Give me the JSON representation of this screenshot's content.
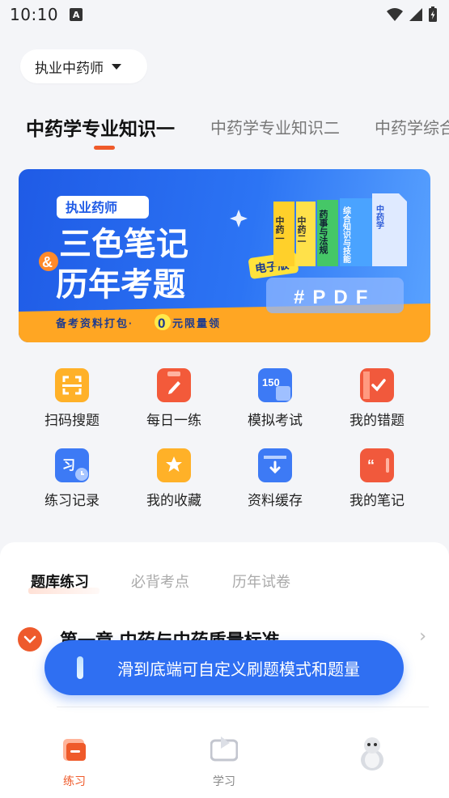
{
  "status_bar": {
    "time": "10:10",
    "notification_icon": "A"
  },
  "exam_selector": {
    "label": "执业中药师",
    "icon": "caret-down-icon"
  },
  "subject_tabs": [
    {
      "label": "中药学专业知识一",
      "active": true
    },
    {
      "label": "中药学专业知识二",
      "active": false
    },
    {
      "label": "中药学综合",
      "active": false
    }
  ],
  "banner": {
    "badge": "执业药师",
    "headline_1": "三色笔记",
    "ampersand": "&",
    "headline_2": "历年考题",
    "edition_tag": "电子版",
    "books": [
      "中药一",
      "中药二",
      "药事与法规",
      "综合知识与技能",
      "中药学"
    ],
    "format_label": "#PDF",
    "footer_text_1": "备考资料打包·",
    "footer_zero": "0",
    "footer_text_2": "元限量领"
  },
  "quick_actions": [
    {
      "label": "扫码搜题",
      "icon": "scan-icon"
    },
    {
      "label": "每日一练",
      "icon": "daily-practice-icon"
    },
    {
      "label": "模拟考试",
      "icon": "mock-exam-icon",
      "icon_text": "150"
    },
    {
      "label": "我的错题",
      "icon": "wrong-questions-icon"
    },
    {
      "label": "练习记录",
      "icon": "practice-record-icon"
    },
    {
      "label": "我的收藏",
      "icon": "favorites-icon"
    },
    {
      "label": "资料缓存",
      "icon": "download-cache-icon"
    },
    {
      "label": "我的笔记",
      "icon": "notes-icon"
    }
  ],
  "sheet_tabs": [
    {
      "label": "题库练习",
      "active": true
    },
    {
      "label": "必背考点",
      "active": false
    },
    {
      "label": "历年试卷",
      "active": false
    }
  ],
  "chapter": {
    "title": "第一章 中药与中药质量标准"
  },
  "toast": {
    "message": "滑到底端可自定义刷题模式和题量"
  },
  "bottom_nav": [
    {
      "label": "练习",
      "active": true
    },
    {
      "label": "学习",
      "active": false
    },
    {
      "label": "",
      "active": false
    }
  ],
  "colors": {
    "accent": "#ef5a2a",
    "primary_blue": "#2f6ff2",
    "banner_orange": "#ffa623"
  }
}
